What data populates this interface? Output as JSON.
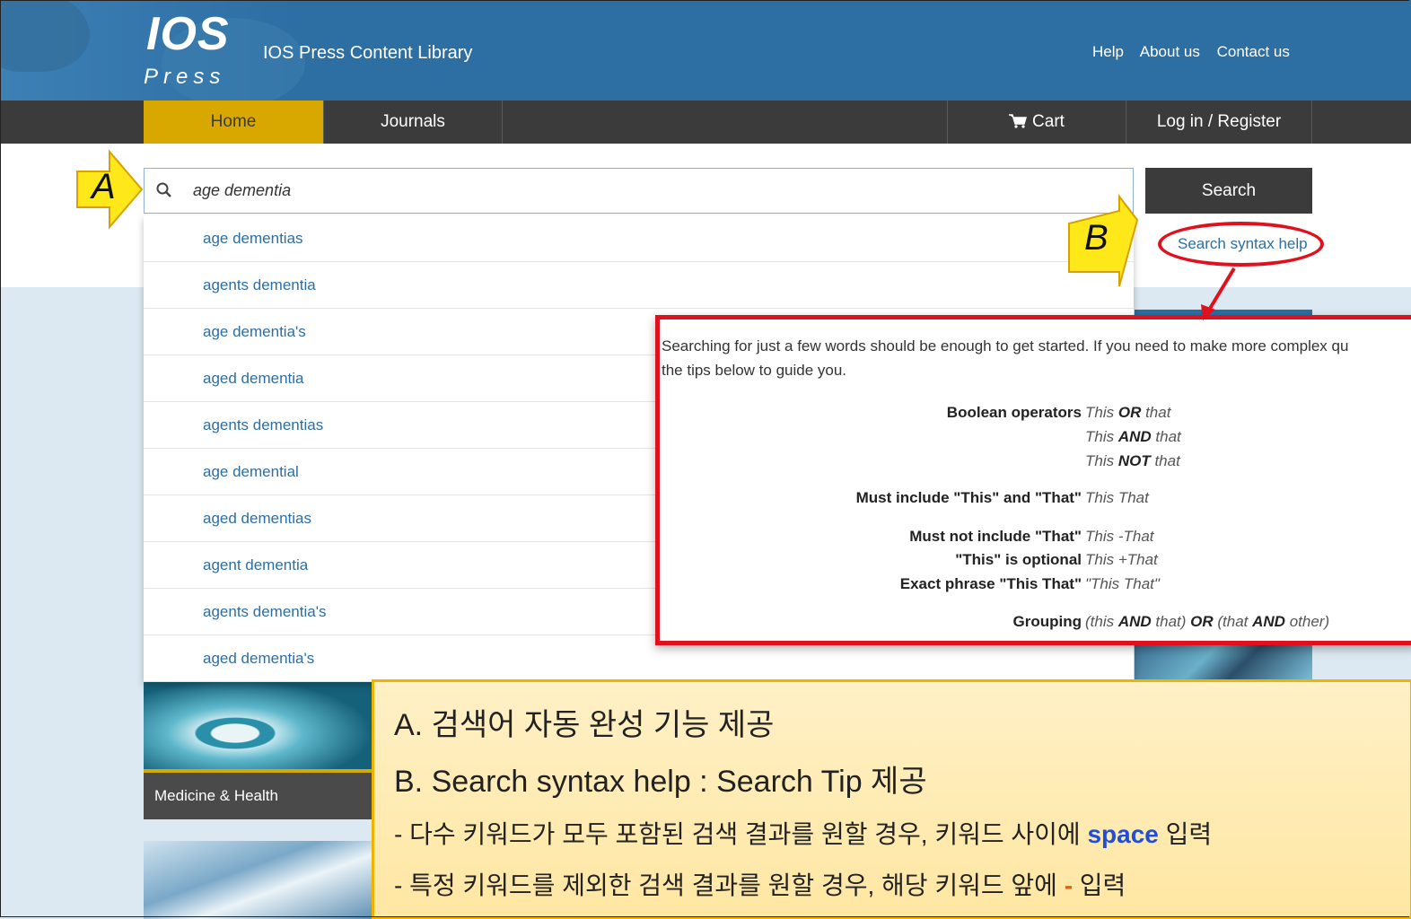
{
  "header": {
    "logo_main": "IOS",
    "logo_sub": "Press",
    "site_title": "IOS Press Content Library",
    "links": [
      "Help",
      "About us",
      "Contact us"
    ]
  },
  "nav": {
    "home": "Home",
    "journals": "Journals",
    "cart": "Cart",
    "login": "Log in / Register"
  },
  "search": {
    "value": "age dementia",
    "button": "Search",
    "syntax_help": "Search syntax help",
    "suggestions": [
      "age dementias",
      "agents dementia",
      "age dementia's",
      "aged dementia",
      "agents dementias",
      "age demential",
      "aged dementias",
      "agent dementia",
      "agents dementia's",
      "aged dementia's"
    ]
  },
  "help_popup": {
    "intro_line1": "Searching for just a few words should be enough to get started. If you need to make more complex qu",
    "intro_line2": "the tips below to guide you.",
    "rows": {
      "boolean_label": "Boolean operators",
      "or_a": "This ",
      "or_op": "OR",
      "or_b": " that",
      "and_a": "This ",
      "and_op": "AND",
      "and_b": " that",
      "not_a": "This ",
      "not_op": "NOT",
      "not_b": " that",
      "must_label": "Must include \"This\" and \"That\"",
      "must_val": "This That",
      "mustnot_label": "Must not include \"That\"",
      "mustnot_val": "This -That",
      "optional_label": "\"This\" is optional",
      "optional_val": "This +That",
      "exact_label": "Exact phrase \"This That\"",
      "exact_val": "\"This That\"",
      "group_label": "Grouping",
      "group_1": "(this ",
      "group_2": "AND",
      "group_3": " that) ",
      "group_4": "OR",
      "group_5": " (that ",
      "group_6": "AND",
      "group_7": " other)"
    }
  },
  "category": {
    "label": "Medicine & Health"
  },
  "callouts": {
    "a": "A",
    "b": "B"
  },
  "note": {
    "line1": "A. 검색어 자동 완성 기능 제공",
    "line2": "B. Search syntax help : Search Tip 제공",
    "line3_pre": "- 다수 키워드가 모두 포함된 검색 결과를 원할 경우, 키워드 사이에 ",
    "line3_kw": "space",
    "line3_post": " 입력",
    "line4_pre": "- 특정 키워드를 제외한 검색 결과를 원할 경우, 해당 키워드 앞에 ",
    "line4_kw": "-",
    "line4_post": "  입력"
  },
  "colors": {
    "header_blue": "#2d6ea3",
    "nav_dark": "#3b3b3b",
    "home_gold": "#d8a800",
    "highlight_red": "#e0111d",
    "note_keyword_blue": "#1f4ed8"
  }
}
